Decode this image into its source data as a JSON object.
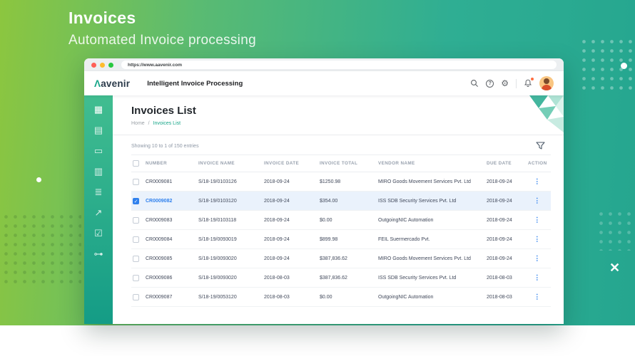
{
  "hero": {
    "title": "Invoices",
    "subtitle": "Automated Invoice processing"
  },
  "decor": {
    "x_glyph": "✕"
  },
  "browser": {
    "url": "https://www.aavenir.com"
  },
  "navbar": {
    "logo_mark": "Λ",
    "logo_text": "avenir",
    "app_title": "Intelligent Invoice Processing",
    "help_glyph": "?",
    "settings_glyph": "⚙"
  },
  "sidebar": {
    "active_index": 0,
    "icons": [
      {
        "name": "dashboard-icon",
        "glyph": "▦"
      },
      {
        "name": "vendors-icon",
        "glyph": "▤"
      },
      {
        "name": "documents-icon",
        "glyph": "▭"
      },
      {
        "name": "invoices-icon",
        "glyph": "▥"
      },
      {
        "name": "tasks-icon",
        "glyph": "≣"
      },
      {
        "name": "analytics-icon",
        "glyph": "↗"
      },
      {
        "name": "approvals-icon",
        "glyph": "☑"
      },
      {
        "name": "access-keys-icon",
        "glyph": "⊶"
      }
    ]
  },
  "list": {
    "title": "Invoices List",
    "breadcrumb": {
      "home": "Home",
      "separator": "/",
      "current": "Invoices List"
    },
    "summary": "Showing 10 to 1 of 150 entries"
  },
  "table": {
    "columns": [
      "NUMBER",
      "INVOICE NAME",
      "INVOICE DATE",
      "INVOICE TOTAL",
      "VENDOR NAME",
      "DUE DATE",
      "ACTION"
    ],
    "action_icon": "⋮",
    "check_glyph": "✓",
    "rows": [
      {
        "number": "CR0009081",
        "invoice_name": "S/18-19/0103126",
        "invoice_date": "2018-09-24",
        "invoice_total": "$1250.98",
        "vendor_name": "MIRO Goods Movement Services Pvt. Ltd",
        "due_date": "2018-09-24",
        "selected": false
      },
      {
        "number": "CR0009082",
        "invoice_name": "S/18-19/0103120",
        "invoice_date": "2018-09-24",
        "invoice_total": "$354.00",
        "vendor_name": "ISS SDB Security Services Pvt. Ltd",
        "due_date": "2018-09-24",
        "selected": true
      },
      {
        "number": "CR0009083",
        "invoice_name": "S/18-19/0103118",
        "invoice_date": "2018-09-24",
        "invoice_total": "$0.00",
        "vendor_name": "OutgoingNIC Automation",
        "due_date": "2018-09-24",
        "selected": false
      },
      {
        "number": "CR0009084",
        "invoice_name": "S/18-19/0093019",
        "invoice_date": "2018-09-24",
        "invoice_total": "$899.98",
        "vendor_name": "FEIL Suermercado Pvt.",
        "due_date": "2018-09-24",
        "selected": false
      },
      {
        "number": "CR0009085",
        "invoice_name": "S/18-19/0093020",
        "invoice_date": "2018-09-24",
        "invoice_total": "$387,836.62",
        "vendor_name": "MIRO Goods Movement Services Pvt. Ltd",
        "due_date": "2018-09-24",
        "selected": false
      },
      {
        "number": "CR0009086",
        "invoice_name": "S/18-19/0093020",
        "invoice_date": "2018-08-03",
        "invoice_total": "$387,836.62",
        "vendor_name": "ISS SDB Security Services Pvt. Ltd",
        "due_date": "2018-08-03",
        "selected": false
      },
      {
        "number": "CR0009087",
        "invoice_name": "S/18-19/0053120",
        "invoice_date": "2018-08-03",
        "invoice_total": "$0.00",
        "vendor_name": "OutgoingNIC Automation",
        "due_date": "2018-08-03",
        "selected": false
      }
    ]
  },
  "colors": {
    "accent": "#18a689",
    "link": "#2f80ed",
    "selected_row": "#eaf2fc",
    "badge": "#ff6d3f"
  }
}
